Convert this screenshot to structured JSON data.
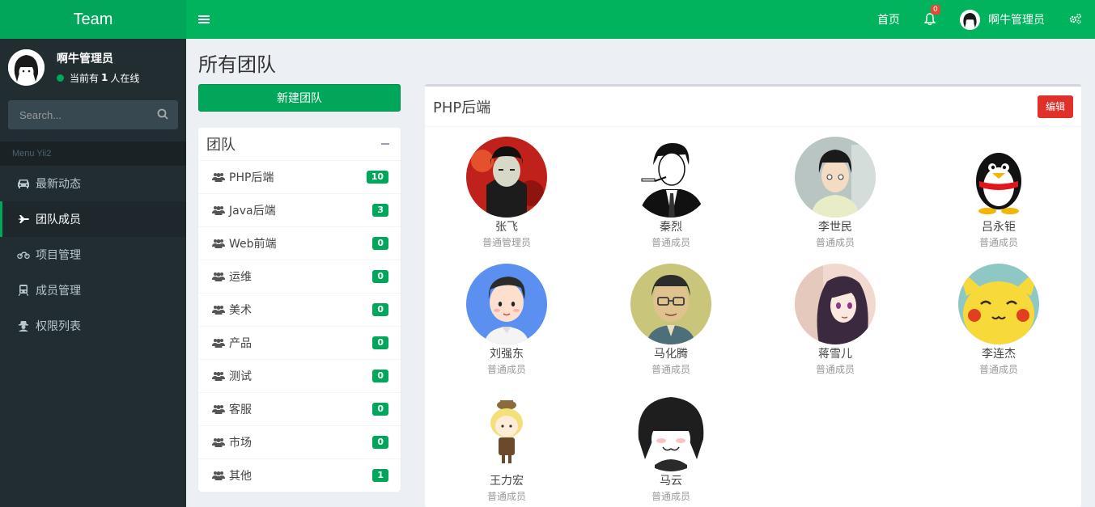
{
  "app": {
    "title": "Team"
  },
  "user": {
    "name": "啊牛管理员",
    "online_prefix": "当前有",
    "online_count": "1",
    "online_suffix": "人在线"
  },
  "search": {
    "placeholder": "Search..."
  },
  "menu": {
    "header": "Menu Yii2",
    "items": [
      {
        "label": "最新动态",
        "icon": "car-icon"
      },
      {
        "label": "团队成员",
        "icon": "plane-icon",
        "active": true
      },
      {
        "label": "项目管理",
        "icon": "motorcycle-icon"
      },
      {
        "label": "成员管理",
        "icon": "train-icon"
      },
      {
        "label": "权限列表",
        "icon": "user-secret-icon"
      }
    ]
  },
  "header": {
    "home": "首页",
    "notifications": "0",
    "user_name": "啊牛管理员"
  },
  "page": {
    "title": "所有团队",
    "new_team_button": "新建团队"
  },
  "teams": {
    "title": "团队",
    "items": [
      {
        "name": "PHP后端",
        "count": "10"
      },
      {
        "name": "Java后端",
        "count": "3"
      },
      {
        "name": "Web前端",
        "count": "0"
      },
      {
        "name": "运维",
        "count": "0"
      },
      {
        "name": "美术",
        "count": "0"
      },
      {
        "name": "产品",
        "count": "0"
      },
      {
        "name": "测试",
        "count": "0"
      },
      {
        "name": "客服",
        "count": "0"
      },
      {
        "name": "市场",
        "count": "0"
      },
      {
        "name": "其他",
        "count": "1"
      }
    ]
  },
  "members_panel": {
    "title": "PHP后端",
    "edit_button": "编辑",
    "members": [
      {
        "name": "张飞",
        "role": "普通管理员"
      },
      {
        "name": "秦烈",
        "role": "普通成员"
      },
      {
        "name": "李世民",
        "role": "普通成员"
      },
      {
        "name": "吕永钜",
        "role": "普通成员"
      },
      {
        "name": "刘强东",
        "role": "普通成员"
      },
      {
        "name": "马化腾",
        "role": "普通成员"
      },
      {
        "name": "蒋雪儿",
        "role": "普通成员"
      },
      {
        "name": "李连杰",
        "role": "普通成员"
      },
      {
        "name": "王力宏",
        "role": "普通成员"
      },
      {
        "name": "马云",
        "role": "普通成员"
      }
    ]
  },
  "colors": {
    "brand": "#00a65a",
    "sidebar": "#222d32",
    "danger": "#dd4b39"
  }
}
